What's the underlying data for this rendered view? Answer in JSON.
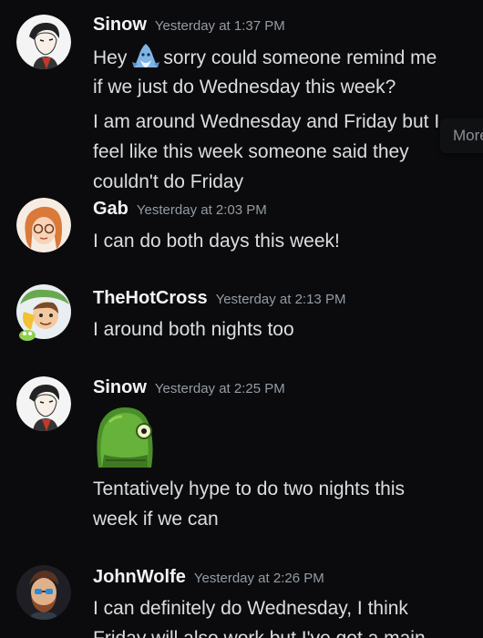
{
  "messages": [
    {
      "username": "Sinow",
      "timestamp": "Yesterday at 1:37 PM",
      "lines": [
        {
          "before": "Hey",
          "emoji": "shark-emoji",
          "after": "sorry could someone remind me"
        },
        "if we just do Wednesday this week?",
        "I am around Wednesday and Friday but I",
        "feel like this week someone said they",
        "couldn't do Friday"
      ]
    },
    {
      "username": "Gab",
      "timestamp": "Yesterday at 2:03 PM",
      "lines": [
        "I can do both days this week!"
      ]
    },
    {
      "username": "TheHotCross",
      "timestamp": "Yesterday at 2:13 PM",
      "lines": [
        "I around both nights too"
      ]
    },
    {
      "username": "Sinow",
      "timestamp": "Yesterday at 2:25 PM",
      "emoji": "green-blob-emoji",
      "lines": [
        "Tentatively hype to do two nights this",
        "week if we can"
      ]
    },
    {
      "username": "JohnWolfe",
      "timestamp": "Yesterday at 2:26 PM",
      "lines": [
        "I can definitely do Wednesday, I think",
        "Friday will also work but I've got a main"
      ]
    }
  ],
  "tooltip": {
    "label": "More"
  },
  "colors": {
    "background": "#0b0b0d",
    "username": "#f2f3f5",
    "timestamp": "#949ba4",
    "text": "#dbdee1"
  }
}
